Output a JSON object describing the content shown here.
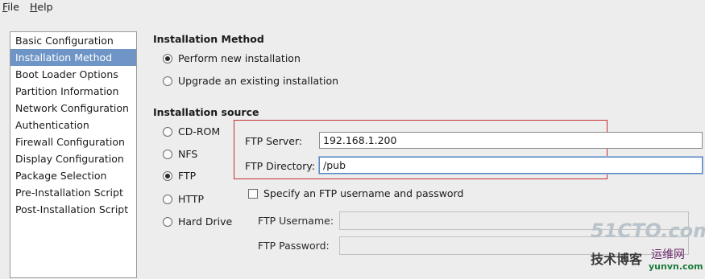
{
  "menu": {
    "file": {
      "underline": "F",
      "rest": "ile"
    },
    "help": {
      "underline": "H",
      "rest": "elp"
    }
  },
  "sidebar": {
    "items": [
      {
        "label": "Basic Configuration"
      },
      {
        "label": "Installation Method",
        "selected": true
      },
      {
        "label": "Boot Loader Options"
      },
      {
        "label": "Partition Information"
      },
      {
        "label": "Network Configuration"
      },
      {
        "label": "Authentication"
      },
      {
        "label": "Firewall Configuration"
      },
      {
        "label": "Display Configuration"
      },
      {
        "label": "Package Selection"
      },
      {
        "label": "Pre-Installation Script"
      },
      {
        "label": "Post-Installation Script"
      }
    ]
  },
  "method": {
    "title": "Installation Method",
    "options": [
      {
        "label": "Perform new installation",
        "checked": true
      },
      {
        "label": "Upgrade an existing installation",
        "checked": false
      }
    ]
  },
  "source": {
    "title": "Installation source",
    "options": [
      {
        "label": "CD-ROM",
        "checked": false
      },
      {
        "label": "NFS",
        "checked": false
      },
      {
        "label": "FTP",
        "checked": true
      },
      {
        "label": "HTTP",
        "checked": false
      },
      {
        "label": "Hard Drive",
        "checked": false
      }
    ]
  },
  "ftp": {
    "server_label": "FTP Server:",
    "server_value": "192.168.1.200",
    "directory_label": "FTP Directory:",
    "directory_value": "/pub",
    "auth_checkbox_label": "Specify an FTP username and password",
    "auth_checked": false,
    "username_label": "FTP Username:",
    "username_value": "",
    "password_label": "FTP Password:",
    "password_value": ""
  },
  "watermark": {
    "line1": "51CTO.com",
    "line2": "技术博客",
    "line3": "运维网",
    "line4": "yunvn.com"
  },
  "colors": {
    "selected_bg": "#6f95c6",
    "highlight_border": "#c73030"
  }
}
